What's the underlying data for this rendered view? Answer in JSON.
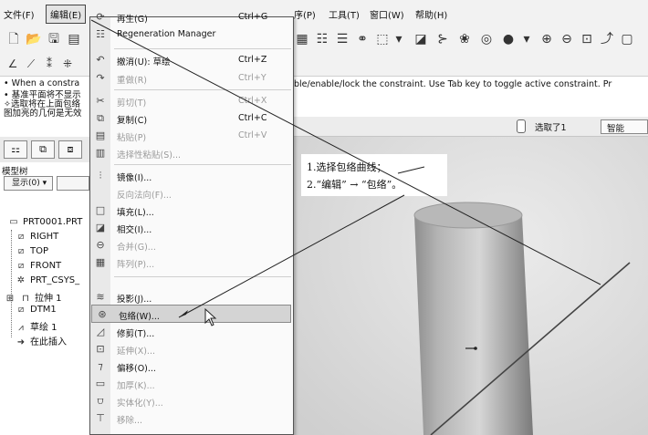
{
  "menubar": {
    "left_items": [
      "文件(F)",
      "编辑(E)"
    ],
    "right_items": [
      "序(P)",
      "工具(T)",
      "窗口(W)",
      "帮助(H)"
    ]
  },
  "message_area": {
    "lines": [
      "• When a constra",
      "• 基准平面将不显示",
      "✧选取将在上面包络",
      "图加亮的几何是无效"
    ],
    "right_text": "ble/enable/lock the constraint. Use Tab key to toggle active constraint. Pr"
  },
  "status_strip": {
    "selection_text": "选取了1",
    "filter_value": "智能"
  },
  "model_tree": {
    "title": "模型树",
    "show_button": "显示(0) ▾",
    "items": [
      "PRT0001.PRT",
      "RIGHT",
      "TOP",
      "FRONT",
      "PRT_CSYS_",
      "拉伸 1",
      "DTM1",
      "草绘 1",
      "在此插入"
    ]
  },
  "edit_menu": {
    "items": [
      {
        "label": "再生(G)",
        "shortcut": "Ctrl+G",
        "icon": "regenerate-icon",
        "enabled": true
      },
      {
        "label": "Regeneration Manager",
        "shortcut": "",
        "icon": "regen-manager-icon",
        "enabled": true
      },
      {
        "label": "撤消(U): 草绘",
        "shortcut": "Ctrl+Z",
        "icon": "undo-icon",
        "enabled": true
      },
      {
        "label": "重做(R)",
        "shortcut": "Ctrl+Y",
        "icon": "redo-icon",
        "enabled": false
      },
      {
        "label": "剪切(T)",
        "shortcut": "Ctrl+X",
        "icon": "cut-icon",
        "enabled": false
      },
      {
        "label": "复制(C)",
        "shortcut": "Ctrl+C",
        "icon": "copy-icon",
        "enabled": true
      },
      {
        "label": "粘贴(P)",
        "shortcut": "Ctrl+V",
        "icon": "paste-icon",
        "enabled": false
      },
      {
        "label": "选择性粘贴(S)...",
        "shortcut": "",
        "icon": "paste-special-icon",
        "enabled": false
      },
      {
        "label": "镜像(I)...",
        "shortcut": "",
        "icon": "mirror-icon",
        "enabled": true
      },
      {
        "label": "反向法向(F)...",
        "shortcut": "",
        "icon": "flip-normal-icon",
        "enabled": false
      },
      {
        "label": "填充(L)...",
        "shortcut": "",
        "icon": "fill-icon",
        "enabled": true
      },
      {
        "label": "相交(I)...",
        "shortcut": "",
        "icon": "intersect-icon",
        "enabled": true
      },
      {
        "label": "合并(G)...",
        "shortcut": "",
        "icon": "merge-icon",
        "enabled": false
      },
      {
        "label": "阵列(P)...",
        "shortcut": "",
        "icon": "pattern-icon",
        "enabled": false
      },
      {
        "label": "投影(J)...",
        "shortcut": "",
        "icon": "project-icon",
        "enabled": true
      },
      {
        "label": "包络(W)...",
        "shortcut": "",
        "icon": "wrap-icon",
        "enabled": true
      },
      {
        "label": "修剪(T)...",
        "shortcut": "",
        "icon": "trim-icon",
        "enabled": true
      },
      {
        "label": "延伸(X)...",
        "shortcut": "",
        "icon": "extend-icon",
        "enabled": false
      },
      {
        "label": "偏移(O)...",
        "shortcut": "",
        "icon": "offset-icon",
        "enabled": true
      },
      {
        "label": "加厚(K)...",
        "shortcut": "",
        "icon": "thicken-icon",
        "enabled": false
      },
      {
        "label": "实体化(Y)...",
        "shortcut": "",
        "icon": "solidify-icon",
        "enabled": false
      },
      {
        "label": "移除...",
        "shortcut": "",
        "icon": "remove-icon",
        "enabled": false
      }
    ],
    "highlighted": "包络(W)..."
  },
  "annotation": {
    "line1": "1.选择包络曲线；",
    "line2": "2.“编辑” → “包络”。"
  },
  "colors": {
    "menu_bg": "#fafafa",
    "highlight": "#d4d4d4",
    "viewport_bg": "#dcdcdc",
    "cylinder_mid": "#cfcfcf",
    "cylinder_dark": "#8a8a8a",
    "sketch_line": "#444444"
  }
}
